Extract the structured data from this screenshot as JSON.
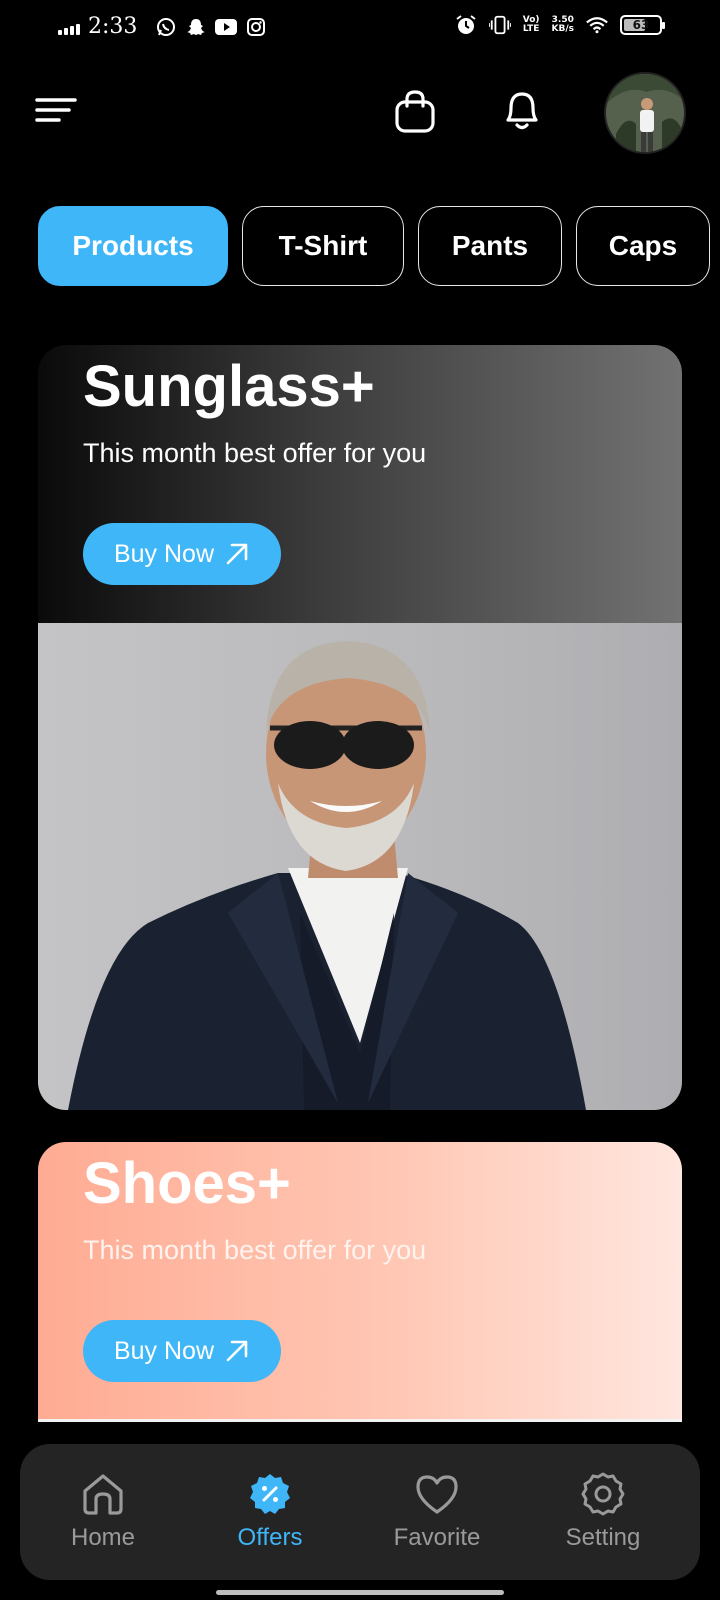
{
  "status_bar": {
    "time": "2:33",
    "network_speed_value": "3.50",
    "network_speed_unit": "KB/s",
    "volte_top": "Vo)",
    "volte_bottom": "LTE",
    "battery": "63",
    "battery_level": 0.63,
    "icons": [
      "signal-icon",
      "whatsapp-icon",
      "snapchat-icon",
      "youtube-icon",
      "instagram-icon",
      "alarm-icon",
      "vibrate-icon",
      "wifi-icon",
      "battery-icon"
    ]
  },
  "header": {
    "icons": [
      "menu-icon",
      "shopping-bag-icon",
      "bell-icon",
      "avatar"
    ]
  },
  "tabs": [
    {
      "label": "Products",
      "active": true
    },
    {
      "label": "T-Shirt",
      "active": false
    },
    {
      "label": "Pants",
      "active": false
    },
    {
      "label": "Caps",
      "active": false
    }
  ],
  "cards": [
    {
      "title": "Sunglass+",
      "subtitle": "This month best offer for you",
      "button": "Buy Now"
    },
    {
      "title": "Shoes+",
      "subtitle": "This month best offer for you",
      "button": "Buy Now"
    }
  ],
  "bottom_nav": [
    {
      "label": "Home",
      "icon": "home-icon",
      "active": false
    },
    {
      "label": "Offers",
      "icon": "offers-badge-icon",
      "active": true
    },
    {
      "label": "Favorite",
      "icon": "heart-icon",
      "active": false
    },
    {
      "label": "Setting",
      "icon": "gear-icon",
      "active": false
    }
  ],
  "colors": {
    "accent": "#3fb6f7",
    "background": "#000000",
    "nav_background": "#242424",
    "shoes_card_start": "#ffab93",
    "shoes_card_end": "#ffe6de"
  }
}
